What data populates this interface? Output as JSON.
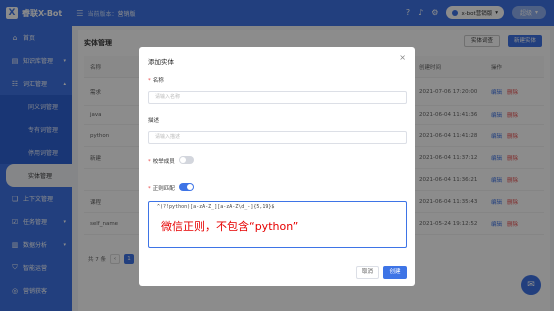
{
  "app": {
    "logo_letter": "X",
    "name": "睿联X-Bot"
  },
  "header": {
    "version_label": "当前版本：",
    "version_value": "营销版",
    "bot_name": "x-bot营销版",
    "user_label": "超级"
  },
  "sidebar": {
    "items": [
      {
        "label": "首页",
        "icon": "home-icon"
      },
      {
        "label": "知识库管理",
        "icon": "book-icon",
        "arrow": "▾"
      },
      {
        "label": "词汇管理",
        "icon": "list-icon",
        "arrow": "▴"
      },
      {
        "label": "同义词管理",
        "sub": true
      },
      {
        "label": "专有词管理",
        "sub": true
      },
      {
        "label": "停用词管理",
        "sub": true
      },
      {
        "label": "实体管理",
        "sub": true,
        "active": true
      },
      {
        "label": "上下文管理",
        "icon": "context-icon"
      },
      {
        "label": "任务管理",
        "icon": "task-icon",
        "arrow": "▾"
      },
      {
        "label": "数据分析",
        "icon": "chart-icon",
        "arrow": "▾"
      },
      {
        "label": "智能运营",
        "icon": "shield-icon"
      },
      {
        "label": "营销获客",
        "icon": "target-icon"
      }
    ]
  },
  "main": {
    "title": "实体管理",
    "btn_query": "实体词查",
    "btn_new": "新建实体",
    "columns": {
      "name": "名称",
      "time": "创建时间",
      "op": "操作"
    },
    "rows": [
      {
        "name": "需求",
        "time": "2021-07-06 17:20:00"
      },
      {
        "name": "java",
        "time": "2021-06-04 11:41:36"
      },
      {
        "name": "python",
        "time": "2021-06-04 11:41:28"
      },
      {
        "name": "新建",
        "time": "2021-06-04 11:37:12"
      },
      {
        "name": "",
        "time": "2021-06-04 11:36:21"
      },
      {
        "name": "课程",
        "time": "2021-06-04 11:35:43"
      },
      {
        "name": "self_name",
        "time": "2021-05-24 19:12:52"
      }
    ],
    "op_edit": "编辑",
    "op_delete": "删除",
    "pager_total": "共 7 条",
    "pager_prev": "‹",
    "pager_page": "1"
  },
  "modal": {
    "title": "添加实体",
    "close": "×",
    "name_label": "名称",
    "name_placeholder": "请输入名称",
    "desc_label": "描述",
    "desc_placeholder": "请输入描述",
    "member_label": "校举成员",
    "member_on": false,
    "regex_label": "正则匹配",
    "regex_on": true,
    "regex_value": "^(?!python)[a-zA-Z_][a-zA-Z\\d_-]{5,19}$",
    "annotation": "微信正则，不包含“python”",
    "btn_cancel": "取消",
    "btn_create": "创建"
  },
  "colors": {
    "primary": "#3e74e6",
    "danger": "#e84b4b",
    "annotation": "#e60000"
  }
}
